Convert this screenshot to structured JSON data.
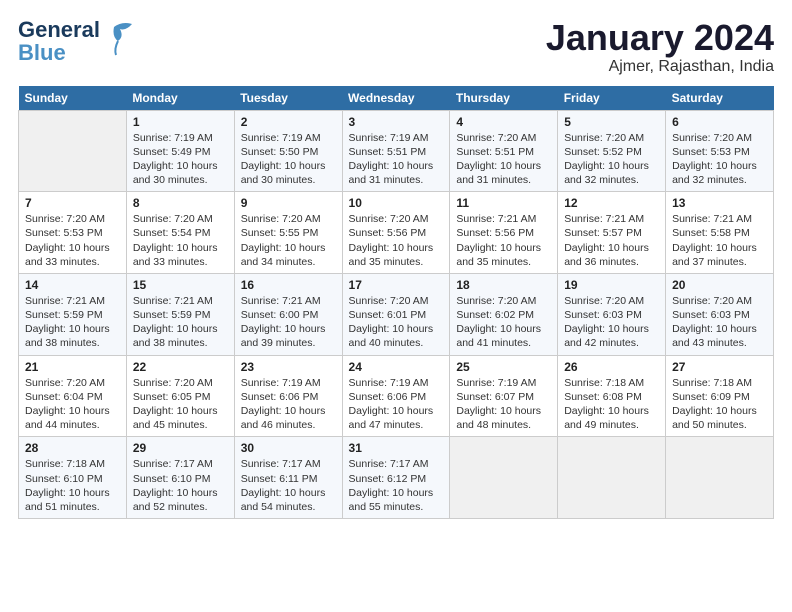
{
  "logo": {
    "line1": "General",
    "line2": "Blue"
  },
  "title": "January 2024",
  "subtitle": "Ajmer, Rajasthan, India",
  "days_header": [
    "Sunday",
    "Monday",
    "Tuesday",
    "Wednesday",
    "Thursday",
    "Friday",
    "Saturday"
  ],
  "weeks": [
    [
      {
        "num": "",
        "info": ""
      },
      {
        "num": "1",
        "info": "Sunrise: 7:19 AM\nSunset: 5:49 PM\nDaylight: 10 hours\nand 30 minutes."
      },
      {
        "num": "2",
        "info": "Sunrise: 7:19 AM\nSunset: 5:50 PM\nDaylight: 10 hours\nand 30 minutes."
      },
      {
        "num": "3",
        "info": "Sunrise: 7:19 AM\nSunset: 5:51 PM\nDaylight: 10 hours\nand 31 minutes."
      },
      {
        "num": "4",
        "info": "Sunrise: 7:20 AM\nSunset: 5:51 PM\nDaylight: 10 hours\nand 31 minutes."
      },
      {
        "num": "5",
        "info": "Sunrise: 7:20 AM\nSunset: 5:52 PM\nDaylight: 10 hours\nand 32 minutes."
      },
      {
        "num": "6",
        "info": "Sunrise: 7:20 AM\nSunset: 5:53 PM\nDaylight: 10 hours\nand 32 minutes."
      }
    ],
    [
      {
        "num": "7",
        "info": "Sunrise: 7:20 AM\nSunset: 5:53 PM\nDaylight: 10 hours\nand 33 minutes."
      },
      {
        "num": "8",
        "info": "Sunrise: 7:20 AM\nSunset: 5:54 PM\nDaylight: 10 hours\nand 33 minutes."
      },
      {
        "num": "9",
        "info": "Sunrise: 7:20 AM\nSunset: 5:55 PM\nDaylight: 10 hours\nand 34 minutes."
      },
      {
        "num": "10",
        "info": "Sunrise: 7:20 AM\nSunset: 5:56 PM\nDaylight: 10 hours\nand 35 minutes."
      },
      {
        "num": "11",
        "info": "Sunrise: 7:21 AM\nSunset: 5:56 PM\nDaylight: 10 hours\nand 35 minutes."
      },
      {
        "num": "12",
        "info": "Sunrise: 7:21 AM\nSunset: 5:57 PM\nDaylight: 10 hours\nand 36 minutes."
      },
      {
        "num": "13",
        "info": "Sunrise: 7:21 AM\nSunset: 5:58 PM\nDaylight: 10 hours\nand 37 minutes."
      }
    ],
    [
      {
        "num": "14",
        "info": "Sunrise: 7:21 AM\nSunset: 5:59 PM\nDaylight: 10 hours\nand 38 minutes."
      },
      {
        "num": "15",
        "info": "Sunrise: 7:21 AM\nSunset: 5:59 PM\nDaylight: 10 hours\nand 38 minutes."
      },
      {
        "num": "16",
        "info": "Sunrise: 7:21 AM\nSunset: 6:00 PM\nDaylight: 10 hours\nand 39 minutes."
      },
      {
        "num": "17",
        "info": "Sunrise: 7:20 AM\nSunset: 6:01 PM\nDaylight: 10 hours\nand 40 minutes."
      },
      {
        "num": "18",
        "info": "Sunrise: 7:20 AM\nSunset: 6:02 PM\nDaylight: 10 hours\nand 41 minutes."
      },
      {
        "num": "19",
        "info": "Sunrise: 7:20 AM\nSunset: 6:03 PM\nDaylight: 10 hours\nand 42 minutes."
      },
      {
        "num": "20",
        "info": "Sunrise: 7:20 AM\nSunset: 6:03 PM\nDaylight: 10 hours\nand 43 minutes."
      }
    ],
    [
      {
        "num": "21",
        "info": "Sunrise: 7:20 AM\nSunset: 6:04 PM\nDaylight: 10 hours\nand 44 minutes."
      },
      {
        "num": "22",
        "info": "Sunrise: 7:20 AM\nSunset: 6:05 PM\nDaylight: 10 hours\nand 45 minutes."
      },
      {
        "num": "23",
        "info": "Sunrise: 7:19 AM\nSunset: 6:06 PM\nDaylight: 10 hours\nand 46 minutes."
      },
      {
        "num": "24",
        "info": "Sunrise: 7:19 AM\nSunset: 6:06 PM\nDaylight: 10 hours\nand 47 minutes."
      },
      {
        "num": "25",
        "info": "Sunrise: 7:19 AM\nSunset: 6:07 PM\nDaylight: 10 hours\nand 48 minutes."
      },
      {
        "num": "26",
        "info": "Sunrise: 7:18 AM\nSunset: 6:08 PM\nDaylight: 10 hours\nand 49 minutes."
      },
      {
        "num": "27",
        "info": "Sunrise: 7:18 AM\nSunset: 6:09 PM\nDaylight: 10 hours\nand 50 minutes."
      }
    ],
    [
      {
        "num": "28",
        "info": "Sunrise: 7:18 AM\nSunset: 6:10 PM\nDaylight: 10 hours\nand 51 minutes."
      },
      {
        "num": "29",
        "info": "Sunrise: 7:17 AM\nSunset: 6:10 PM\nDaylight: 10 hours\nand 52 minutes."
      },
      {
        "num": "30",
        "info": "Sunrise: 7:17 AM\nSunset: 6:11 PM\nDaylight: 10 hours\nand 54 minutes."
      },
      {
        "num": "31",
        "info": "Sunrise: 7:17 AM\nSunset: 6:12 PM\nDaylight: 10 hours\nand 55 minutes."
      },
      {
        "num": "",
        "info": ""
      },
      {
        "num": "",
        "info": ""
      },
      {
        "num": "",
        "info": ""
      }
    ]
  ]
}
